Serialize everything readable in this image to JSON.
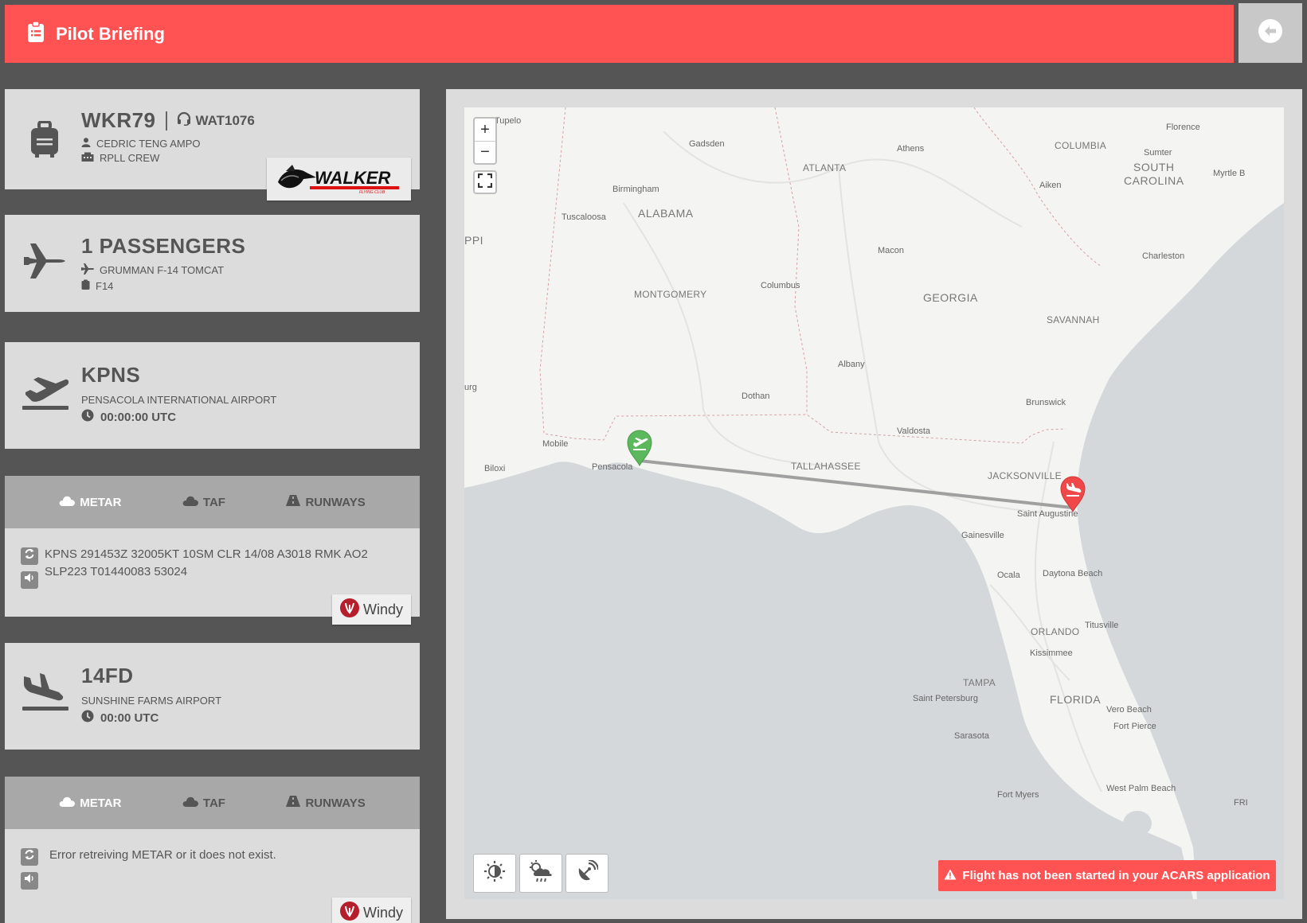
{
  "header": {
    "title": "Pilot Briefing"
  },
  "pilot": {
    "flight_number": "WKR79",
    "callsign": "WAT1076",
    "name": "CEDRIC TENG AMPO",
    "base": "RPLL CREW",
    "airline_logo_text": "WALKER",
    "airline_logo_subtext": "FLYING CLUB"
  },
  "aircraft": {
    "passengers": "1 PASSENGERS",
    "type": "GRUMMAN F-14 TOMCAT",
    "code": "F14"
  },
  "departure": {
    "icao": "KPNS",
    "name": "PENSACOLA INTERNATIONAL AIRPORT",
    "time": "00:00:00 UTC",
    "weather": {
      "tabs": [
        "METAR",
        "TAF",
        "RUNWAYS"
      ],
      "active_tab": "METAR",
      "text": "KPNS 291453Z 32005KT 10SM CLR 14/08 A3018 RMK AO2 SLP223 T01440083 53024",
      "windy_label": "Windy"
    }
  },
  "arrival": {
    "icao": "14FD",
    "name": "SUNSHINE FARMS AIRPORT",
    "time": "00:00 UTC",
    "weather": {
      "tabs": [
        "METAR",
        "TAF",
        "RUNWAYS"
      ],
      "active_tab": "METAR",
      "text": "Error retreiving METAR or it does not exist.",
      "windy_label": "Windy"
    }
  },
  "map": {
    "zoom_in": "+",
    "zoom_out": "−",
    "alert": "Flight has not been started in your ACARS application",
    "labels": {
      "tupelo": "Tupelo",
      "gadsden": "Gadsden",
      "athens": "Athens",
      "florence": "Florence",
      "columbia": "COLUMBIA",
      "sumter": "Sumter",
      "south_carolina": "SOUTH\nCAROLINA",
      "myrtle": "Myrtle B",
      "atlanta": "ATLANTA",
      "birmingham": "Birmingham",
      "aiken": "Aiken",
      "alabama": "ALABAMA",
      "tuscaloosa": "Tuscaloosa",
      "ppi": "PPI",
      "macon": "Macon",
      "charleston": "Charleston",
      "columbus": "Columbus",
      "montgomery": "MONTGOMERY",
      "georgia": "GEORGIA",
      "savannah": "SAVANNAH",
      "albany": "Albany",
      "urg": "urg",
      "dothan": "Dothan",
      "brunswick": "Brunswick",
      "valdosta": "Valdosta",
      "mobile": "Mobile",
      "biloxi": "Biloxi",
      "pensacola": "Pensacola",
      "tallahassee": "TALLAHASSEE",
      "jacksonville": "JACKSONVILLE",
      "saint_augustine": "Saint Augustine",
      "gainesville": "Gainesville",
      "ocala": "Ocala",
      "daytona": "Daytona Beach",
      "titusville": "Titusville",
      "orlando": "ORLANDO",
      "kissimmee": "Kissimmee",
      "tampa": "TAMPA",
      "saint_petersburg": "Saint Petersburg",
      "florida": "FLORIDA",
      "vero": "Vero Beach",
      "fort_pierce": "Fort Pierce",
      "sarasota": "Sarasota",
      "fort_myers": "Fort Myers",
      "west_palm": "West Palm Beach",
      "fri": "FRI"
    }
  },
  "colors": {
    "accent": "#ff5252",
    "departure_marker": "#5cb85c",
    "arrival_marker": "#f04848",
    "water": "#d4d8da",
    "land": "#f4f4f2"
  }
}
